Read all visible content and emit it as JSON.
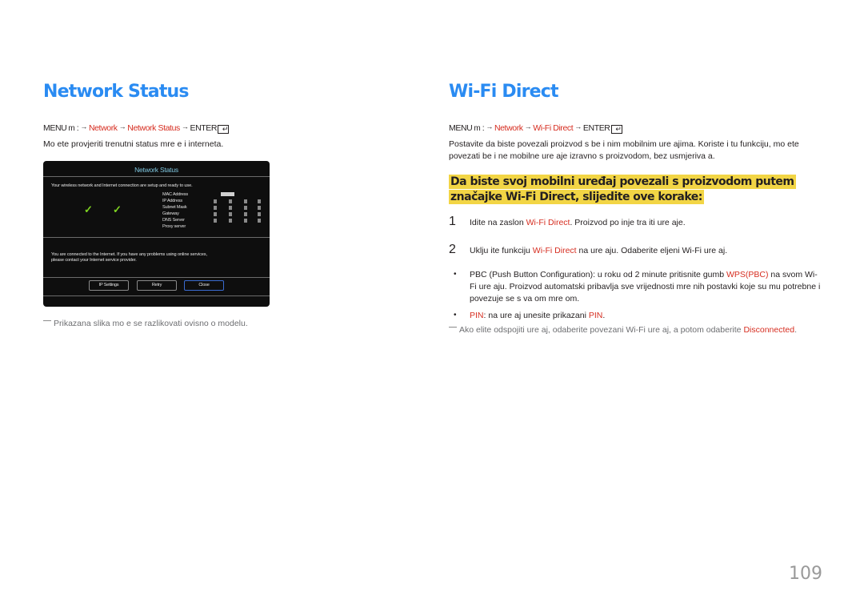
{
  "left": {
    "title": "Network Status",
    "menu_path": {
      "menu": "MENU",
      "menu_icon": "m",
      "sep": ":",
      "items": [
        "Network",
        "Network Status"
      ],
      "enter": "ENTER"
    },
    "description": "Mo ete provjeriti trenutni status mre e i interneta.",
    "dialog": {
      "title": "Network Status",
      "status_message": "Your wireless network and Internet connection are setup and ready to use.",
      "labels": [
        "MAC Address",
        "IP Address",
        "Subnet Mask",
        "Gateway",
        "DNS Server",
        "Proxy server"
      ],
      "internet_message_line1": "You are connected to the Internet. If you have any problems using online services,",
      "internet_message_line2": "please contact your Internet service provider.",
      "buttons": [
        "IP Settings",
        "Retry",
        "Close"
      ],
      "check_icon": "✓"
    },
    "note": "Prikazana slika mo e se razlikovati ovisno o modelu."
  },
  "right": {
    "title": "Wi-Fi Direct",
    "menu_path": {
      "menu": "MENU",
      "menu_icon": "m",
      "sep": ":",
      "items": [
        "Network",
        "Wi-Fi Direct"
      ],
      "enter": "ENTER"
    },
    "description_line1": "Postavite da biste povezali proizvod s be i nim mobilnim ure ajima. Koriste i tu funkciju, mo ete",
    "description_line2": "povezati be i ne mobilne ure aje izravno s proizvodom, bez usmjeriva a.",
    "highlight_line1": "Da biste svoj mobilni uređaj povezali s proizvodom putem",
    "highlight_line2": "značajke Wi-Fi Direct, slijedite ove korake:",
    "steps": [
      {
        "num": "1",
        "pre": "Idite na zaslon ",
        "link": "Wi-Fi Direct",
        "post": ". Proizvod po inje tra iti ure aje."
      },
      {
        "num": "2",
        "pre": "Uklju ite funkciju ",
        "link": "Wi-Fi Direct",
        "post": " na ure aju. Odaberite  eljeni Wi-Fi ure aj."
      }
    ],
    "bullets": {
      "pbc_line1_pre": "PBC (Push Button Configuration): u roku od 2 minute pritisnite gumb ",
      "pbc_link": "WPS(PBC)",
      "pbc_line1_post": " na svom Wi-",
      "pbc_line2": "Fi ure aju. Proizvod automatski pribavlja sve vrijednosti mre nih postavki koje su mu potrebne i",
      "pbc_line3": "povezuje se s va om mre om.",
      "pin_link": "PIN",
      "pin_text": ": na ure aj unesite prikazani ",
      "pin_link2": "PIN",
      "pin_end": ".",
      "bullet_char": "•"
    },
    "note_pre": "Ako  elite odspojiti ure aj, odaberite povezani Wi-Fi ure aj, a potom odaberite ",
    "note_link": "Disconnected",
    "note_end": "."
  },
  "page_number": "109",
  "arrow": "→",
  "enter_glyph": "↵"
}
